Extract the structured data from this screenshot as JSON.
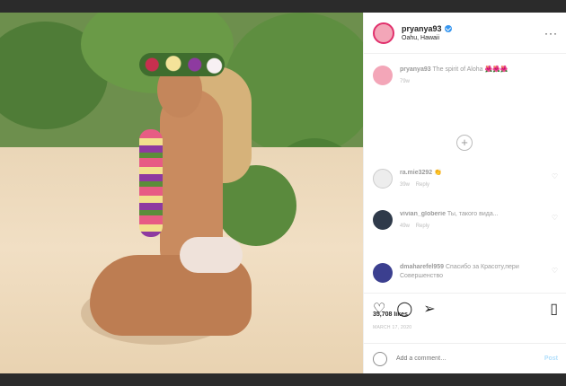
{
  "header": {
    "username": "pryanya93",
    "location": "Oahu, Hawaii",
    "more_icon": "ellipsis-icon"
  },
  "caption": {
    "username": "pryanya93",
    "text": "The spirit of Aloha 🌺🌺🌺",
    "time": "79w"
  },
  "comments": [
    {
      "username": "ra.mie3292",
      "text": "👏",
      "time": "39w",
      "reply": "Reply"
    },
    {
      "username": "vivian_globerie",
      "text": "Ты, такого вида...",
      "time": "49w",
      "reply": "Reply"
    },
    {
      "username": "dmaharefel959",
      "text": "Спасибо за Красоту,пери Совершенство",
      "time": "",
      "reply": ""
    }
  ],
  "actions": {
    "like_icon": "heart-icon",
    "comment_icon": "comment-icon",
    "share_icon": "paper-plane-icon",
    "save_icon": "bookmark-icon"
  },
  "likes": "35,708 likes",
  "date": "MARCH 17, 2020",
  "add_comment": {
    "placeholder": "Add a comment…",
    "post_label": "Post"
  },
  "colors": {
    "accent": "#3897f0",
    "ring": "#e1306c"
  }
}
